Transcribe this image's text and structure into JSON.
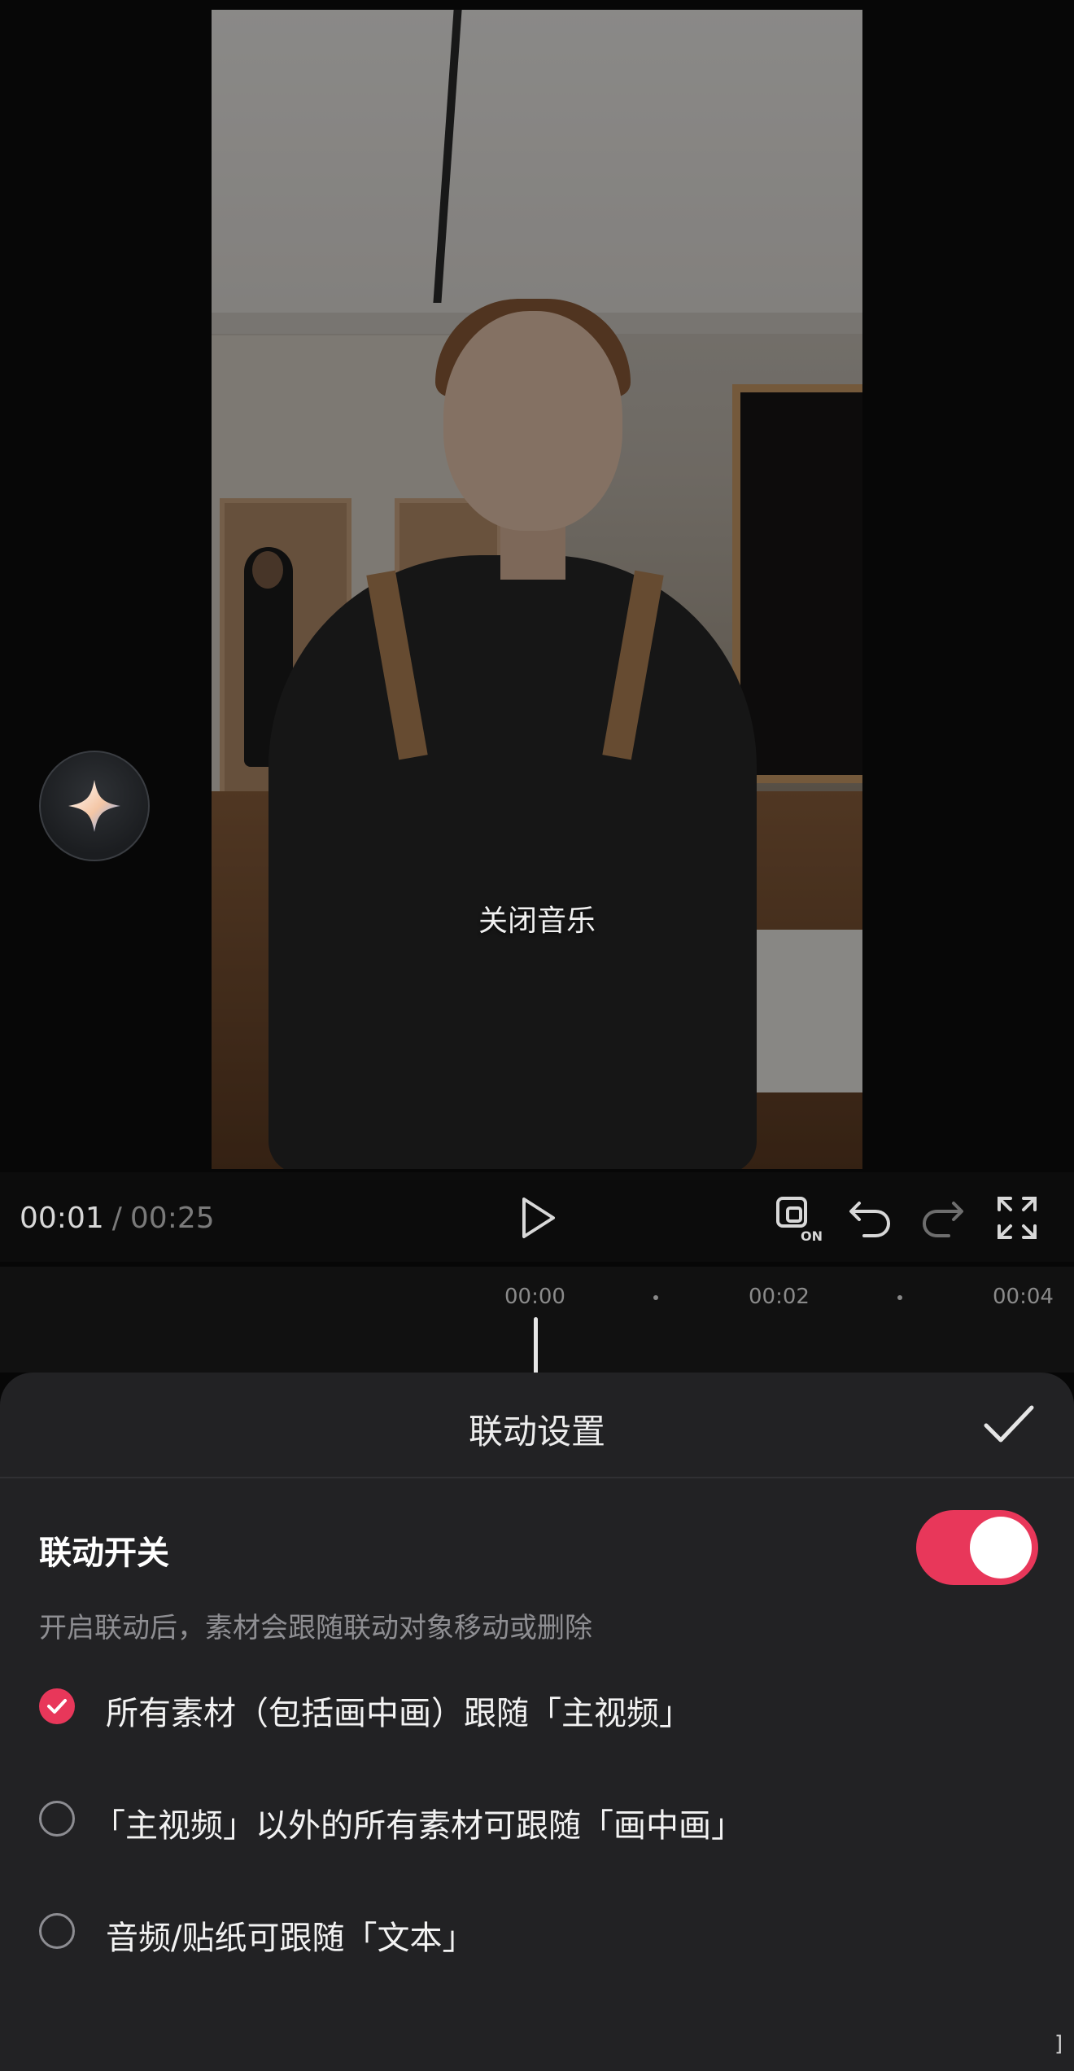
{
  "video": {
    "caption": "关闭音乐"
  },
  "ai_button": {
    "icon": "sparkle-icon"
  },
  "controls": {
    "current_time": "00:01",
    "separator": "/",
    "total_time": "00:25",
    "icons": [
      "play-icon",
      "linkage-on-icon",
      "undo-icon",
      "redo-icon",
      "fullscreen-icon"
    ],
    "linkage_badge": "ON"
  },
  "timeline": {
    "ticks": [
      "00:00",
      "00:02",
      "00:04"
    ]
  },
  "sheet": {
    "title": "联动设置",
    "switch_label": "联动开关",
    "switch_on": true,
    "hint": "开启联动后，素材会跟随联动对象移动或删除",
    "options": [
      {
        "label": "所有素材（包括画中画）跟随「主视频」",
        "selected": true
      },
      {
        "label": "「主视频」以外的所有素材可跟随「画中画」",
        "selected": false
      },
      {
        "label": "音频/贴纸可跟随「文本」",
        "selected": false
      }
    ],
    "accent_color": "#e8375a"
  },
  "corner_mark": "]"
}
